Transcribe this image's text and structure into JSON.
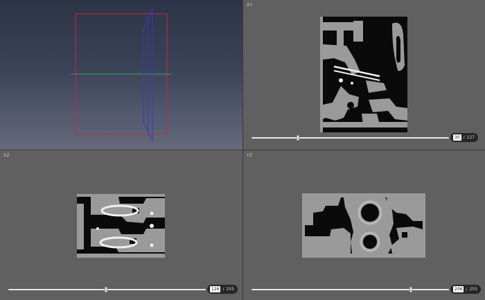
{
  "views": {
    "xy": {
      "label": "XY",
      "slice_value": "30",
      "slice_total": "127",
      "position": 0.236
    },
    "xz": {
      "label": "XZ",
      "slice_value": "126",
      "slice_total": "255",
      "position": 0.494
    },
    "yz": {
      "label": "YZ",
      "slice_value": "206",
      "slice_total": "255",
      "position": 0.808
    }
  },
  "separator": "/",
  "colors": {
    "bounding_box": "#c8283a",
    "slice_plane": "#3538c8",
    "axis_line": "#2fa84a",
    "background": "#5f5f5f",
    "counter_bg": "#262626"
  }
}
